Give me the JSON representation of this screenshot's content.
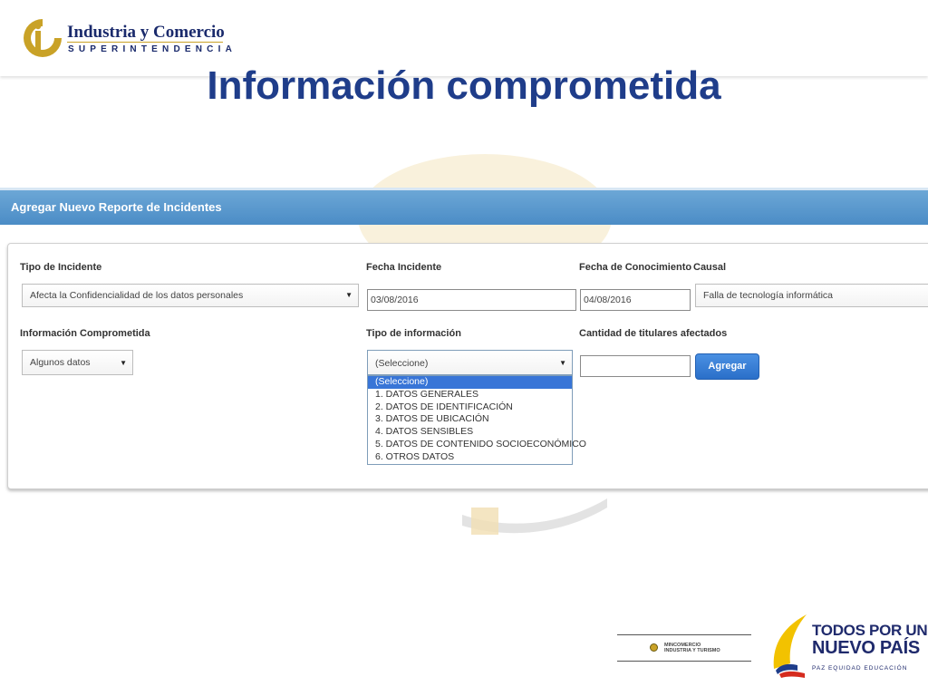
{
  "brand": {
    "title": "Industria y Comercio",
    "subtitle": "SUPERINTENDENCIA"
  },
  "slide_title": "Información comprometida",
  "panel": {
    "title": "Agregar Nuevo Reporte de Incidentes"
  },
  "form": {
    "tipo_incidente": {
      "label": "Tipo de Incidente",
      "value": "Afecta la Confidencialidad de los datos personales"
    },
    "fecha_incidente": {
      "label": "Fecha Incidente",
      "value": "03/08/2016"
    },
    "fecha_conocimiento": {
      "label": "Fecha de Conocimiento",
      "value": "04/08/2016"
    },
    "causal": {
      "label": "Causal",
      "value": "Falla de tecnología informática"
    },
    "info_comprometida": {
      "label": "Información Comprometida",
      "value": "Algunos datos"
    },
    "tipo_informacion": {
      "label": "Tipo de información",
      "value": "(Seleccione)",
      "options": [
        "(Seleccione)",
        "1. DATOS GENERALES",
        "2. DATOS DE IDENTIFICACIÓN",
        "3. DATOS DE UBICACIÓN",
        "4. DATOS SENSIBLES",
        "5. DATOS DE CONTENIDO SOCIOECONÓMICO",
        "6. OTROS DATOS"
      ]
    },
    "cantidad_titulares": {
      "label": "Cantidad de titulares afectados",
      "value": ""
    },
    "agregar_label": "Agregar"
  },
  "footer": {
    "ministry_line1": "MINCOMERCIO",
    "ministry_line2": "INDUSTRIA Y TURISMO",
    "slogan_line1": "TODOS POR UN",
    "slogan_line2": "NUEVO PAÍS",
    "slogan_line3": "PAZ  EQUIDAD  EDUCACIÓN"
  },
  "colors": {
    "title_blue": "#1f3d8a",
    "panel_blue": "#5a98cd",
    "button_blue": "#3a7fd6",
    "gold": "#c9a227"
  }
}
